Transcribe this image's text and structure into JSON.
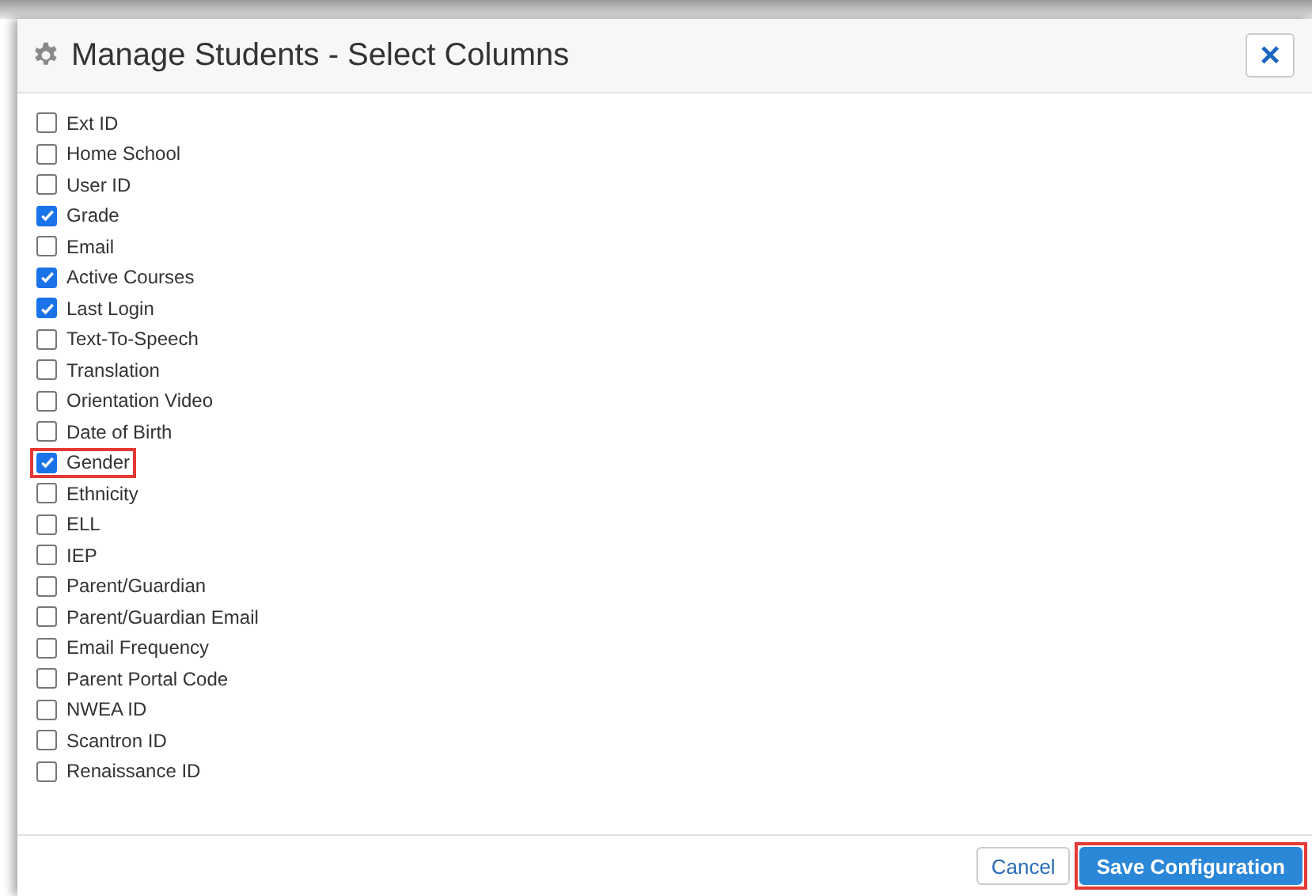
{
  "dialog": {
    "title": "Manage Students - Select Columns",
    "close_label": "×",
    "columns": [
      {
        "label": "Ext ID",
        "checked": false,
        "highlighted": false
      },
      {
        "label": "Home School",
        "checked": false,
        "highlighted": false
      },
      {
        "label": "User ID",
        "checked": false,
        "highlighted": false
      },
      {
        "label": "Grade",
        "checked": true,
        "highlighted": false
      },
      {
        "label": "Email",
        "checked": false,
        "highlighted": false
      },
      {
        "label": "Active Courses",
        "checked": true,
        "highlighted": false
      },
      {
        "label": "Last Login",
        "checked": true,
        "highlighted": false
      },
      {
        "label": "Text-To-Speech",
        "checked": false,
        "highlighted": false
      },
      {
        "label": "Translation",
        "checked": false,
        "highlighted": false
      },
      {
        "label": "Orientation Video",
        "checked": false,
        "highlighted": false
      },
      {
        "label": "Date of Birth",
        "checked": false,
        "highlighted": false
      },
      {
        "label": "Gender",
        "checked": true,
        "highlighted": true
      },
      {
        "label": "Ethnicity",
        "checked": false,
        "highlighted": false
      },
      {
        "label": "ELL",
        "checked": false,
        "highlighted": false
      },
      {
        "label": "IEP",
        "checked": false,
        "highlighted": false
      },
      {
        "label": "Parent/Guardian",
        "checked": false,
        "highlighted": false
      },
      {
        "label": "Parent/Guardian Email",
        "checked": false,
        "highlighted": false
      },
      {
        "label": "Email Frequency",
        "checked": false,
        "highlighted": false
      },
      {
        "label": "Parent Portal Code",
        "checked": false,
        "highlighted": false
      },
      {
        "label": "NWEA ID",
        "checked": false,
        "highlighted": false
      },
      {
        "label": "Scantron ID",
        "checked": false,
        "highlighted": false
      },
      {
        "label": "Renaissance ID",
        "checked": false,
        "highlighted": false
      }
    ],
    "buttons": [
      {
        "label": "Cancel",
        "kind": "secondary",
        "highlighted": false
      },
      {
        "label": "Save Configuration",
        "kind": "primary",
        "highlighted": true
      }
    ]
  }
}
